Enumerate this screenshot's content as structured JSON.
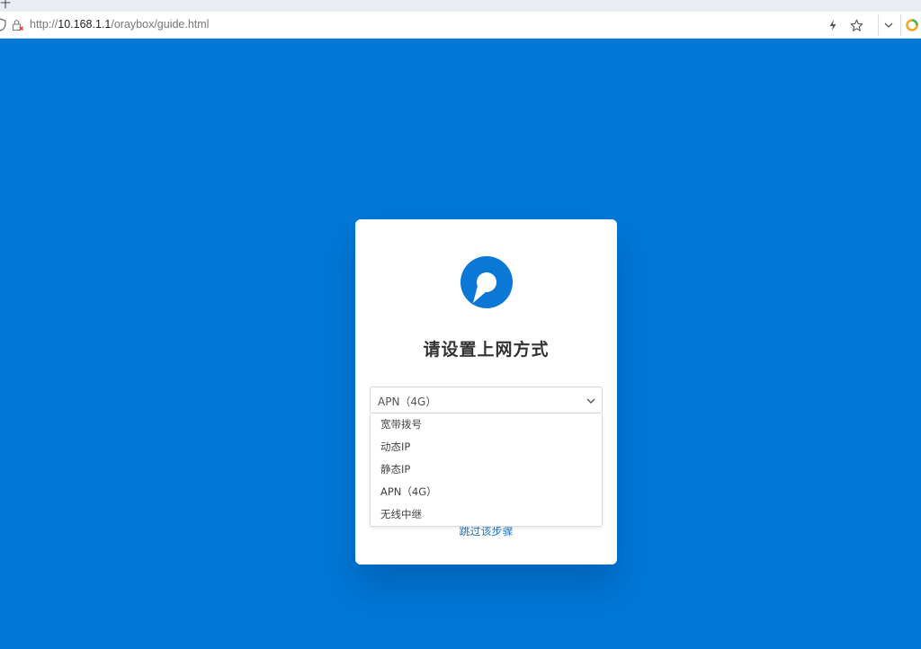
{
  "browser": {
    "title_glyph": "十",
    "url_prefix": "http://",
    "url_host": "10.168.1.1",
    "url_path": "/oraybox/guide.html"
  },
  "icons": {
    "shield": "shield-icon",
    "lock": "insecure-lock-icon",
    "bolt": "lightning-icon",
    "star": "star-icon",
    "chevron": "chevron-down-icon",
    "extension": "extension-ring-icon",
    "logo": "oray-logo-icon"
  },
  "colors": {
    "background": "#0078d7",
    "logo": "#0a78d4",
    "link": "#1a73c8"
  },
  "guide": {
    "heading": "请设置上网方式",
    "selected": "APN（4G）",
    "options": [
      "宽带拨号",
      "动态IP",
      "静态IP",
      "APN（4G）",
      "无线中继"
    ],
    "skip_label": "跳过该步骤"
  }
}
